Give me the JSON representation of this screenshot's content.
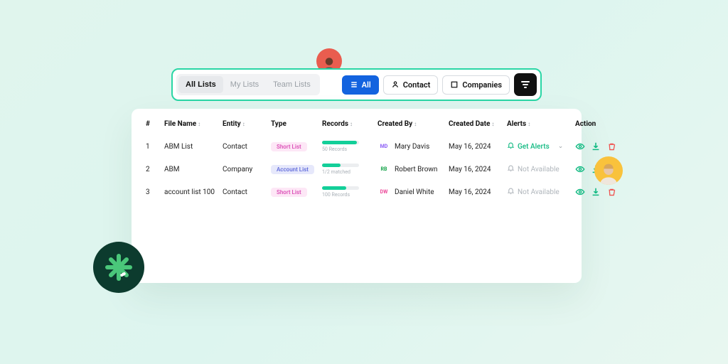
{
  "toolbar": {
    "segments": [
      "All Lists",
      "My Lists",
      "Team Lists"
    ],
    "active_segment": 0,
    "buttons": {
      "all": "All",
      "contact": "Contact",
      "companies": "Companies"
    }
  },
  "table": {
    "headers": {
      "idx": "#",
      "file": "File Name",
      "entity": "Entity",
      "type": "Type",
      "records": "Records",
      "creator": "Created By",
      "date": "Created Date",
      "alerts": "Alerts",
      "action": "Action"
    },
    "rows": [
      {
        "n": "1",
        "file": "ABM List",
        "entity": "Contact",
        "type": "Short List",
        "type_class": "short",
        "records_fill": "95%",
        "records_sub": "50 Records",
        "initials": "MD",
        "ini_class": "ini-md",
        "name": "Mary Davis",
        "date": "May 16, 2024",
        "alert_label": "Get Alerts",
        "alert_active": true
      },
      {
        "n": "2",
        "file": "ABM",
        "entity": "Company",
        "type": "Account List",
        "type_class": "account",
        "records_fill": "50%",
        "records_sub": "1/2 matched",
        "initials": "RB",
        "ini_class": "ini-rb",
        "name": "Robert Brown",
        "date": "May 16, 2024",
        "alert_label": "Not Available",
        "alert_active": false
      },
      {
        "n": "3",
        "file": "account list 100",
        "entity": "Contact",
        "type": "Short List",
        "type_class": "short",
        "records_fill": "65%",
        "records_sub": "100 Records",
        "initials": "DW",
        "ini_class": "ini-dw",
        "name": "Daniel White",
        "date": "May 16, 2024",
        "alert_label": "Not Available",
        "alert_active": false
      }
    ]
  }
}
